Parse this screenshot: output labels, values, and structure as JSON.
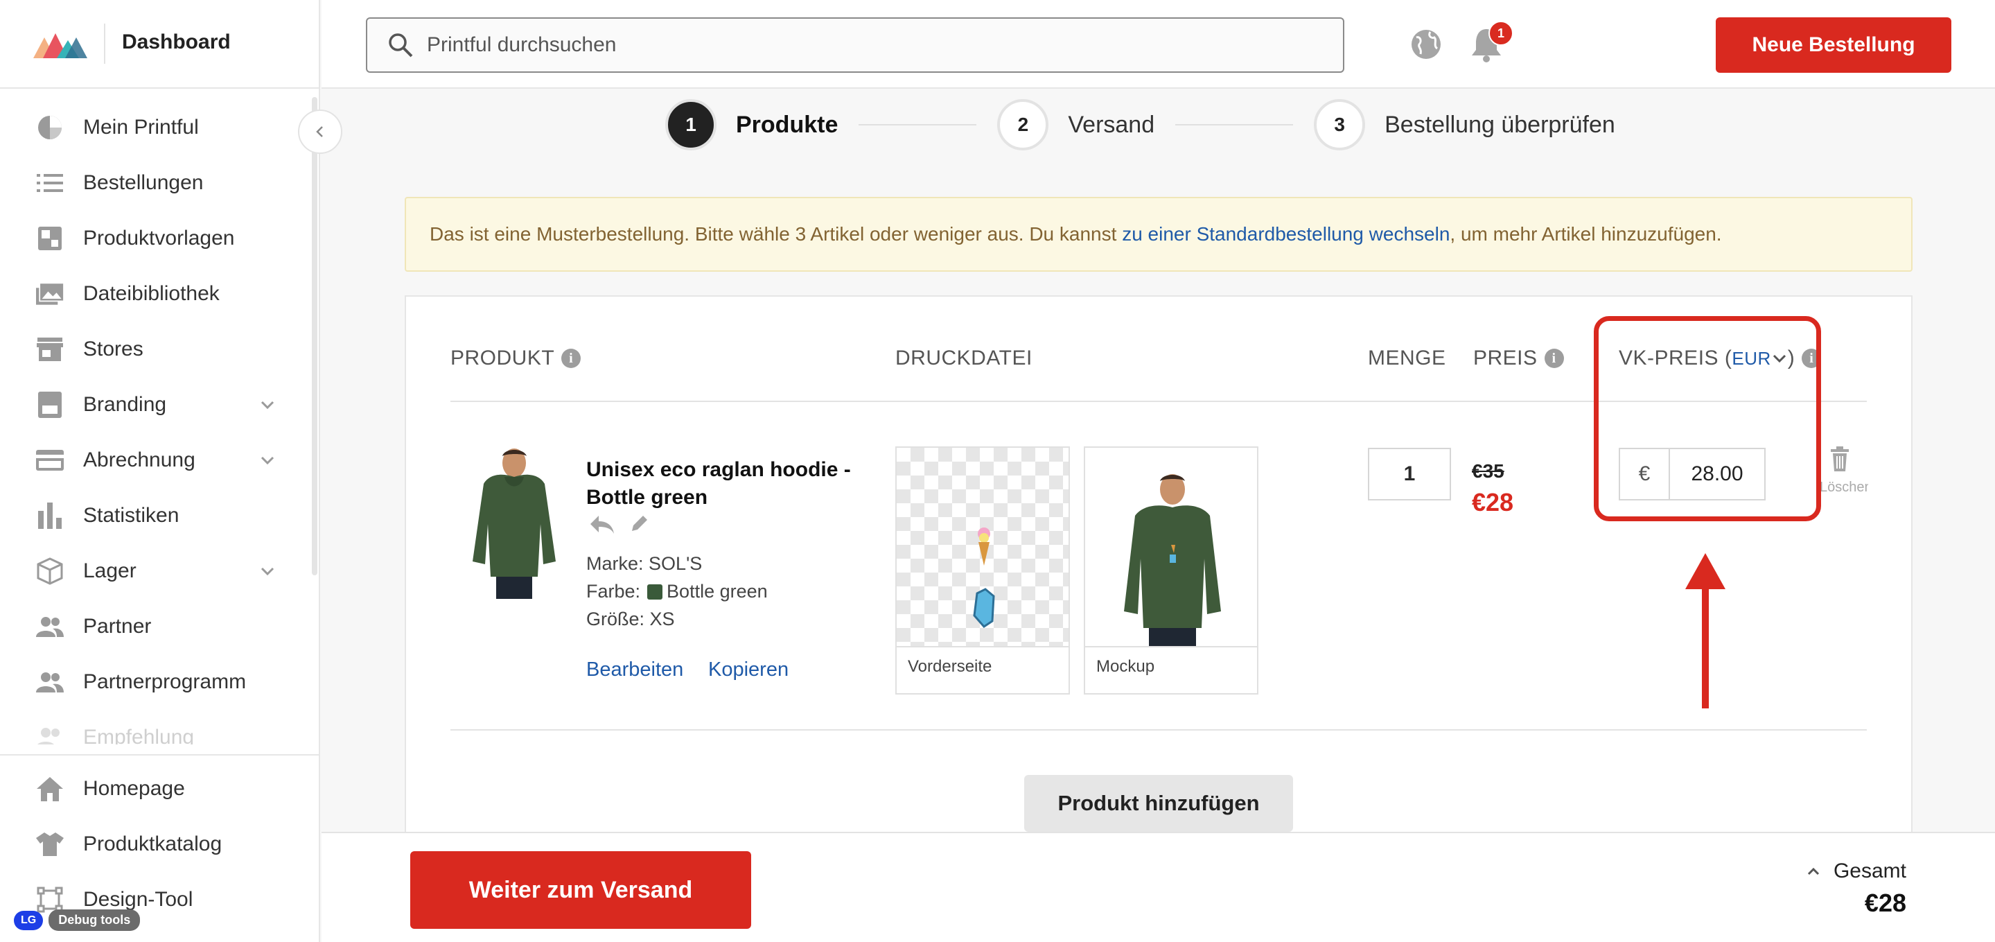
{
  "app": {
    "title": "Dashboard"
  },
  "sidebar": {
    "items": [
      {
        "label": "Mein Printful",
        "icon": "pie-chart-icon"
      },
      {
        "label": "Bestellungen",
        "icon": "list-icon"
      },
      {
        "label": "Produktvorlagen",
        "icon": "template-icon"
      },
      {
        "label": "Dateibibliothek",
        "icon": "images-icon"
      },
      {
        "label": "Stores",
        "icon": "store-icon"
      },
      {
        "label": "Branding",
        "icon": "branding-icon",
        "expandable": true
      },
      {
        "label": "Abrechnung",
        "icon": "credit-card-icon",
        "expandable": true
      },
      {
        "label": "Statistiken",
        "icon": "bar-chart-icon"
      },
      {
        "label": "Lager",
        "icon": "box-icon",
        "expandable": true
      },
      {
        "label": "Partner",
        "icon": "people-icon"
      },
      {
        "label": "Partnerprogramm",
        "icon": "people-icon"
      },
      {
        "label": "Empfehlung",
        "icon": "people-icon"
      }
    ],
    "bottom_items": [
      {
        "label": "Homepage",
        "icon": "home-icon"
      },
      {
        "label": "Produktkatalog",
        "icon": "tshirt-icon"
      },
      {
        "label": "Design-Tool",
        "icon": "design-tool-icon"
      }
    ]
  },
  "debug": {
    "initials": "LG",
    "label": "Debug tools"
  },
  "header": {
    "search_placeholder": "Printful durchsuchen",
    "notification_count": "1",
    "new_order_label": "Neue Bestellung"
  },
  "steps": [
    {
      "number": "1",
      "label": "Produkte",
      "active": true
    },
    {
      "number": "2",
      "label": "Versand",
      "active": false
    },
    {
      "number": "3",
      "label": "Bestellung überprüfen",
      "active": false
    }
  ],
  "notice": {
    "text_before": "Das ist eine Musterbestellung. Bitte wähle 3 Artikel oder weniger aus. Du kannst ",
    "link": "zu einer Standardbestellung wechseln",
    "text_after": ", um mehr Artikel hinzuzufügen."
  },
  "table": {
    "headers": {
      "product": "PRODUKT",
      "print_file": "DRUCKDATEI",
      "quantity": "MENGE",
      "price": "PREIS",
      "retail_price": "VK-PREIS (",
      "currency": "EUR",
      "retail_close": ")"
    },
    "row": {
      "title": "Unisex eco raglan hoodie - Bottle green",
      "brand_label": "Marke:",
      "brand": "SOL'S",
      "color_label": "Farbe:",
      "color": "Bottle green",
      "color_hex": "#3a5a3a",
      "size_label": "Größe:",
      "size": "XS",
      "edit": "Bearbeiten",
      "copy": "Kopieren",
      "files": [
        {
          "caption": "Vorderseite"
        },
        {
          "caption": "Mockup"
        }
      ],
      "quantity": "1",
      "old_price": "€35",
      "price": "€28",
      "retail_currency_symbol": "€",
      "retail_value": "28.00",
      "delete": "Löschen"
    }
  },
  "add_product_label": "Produkt hinzufügen",
  "footer": {
    "next_label": "Weiter zum Versand",
    "total_label": "Gesamt",
    "total_value": "€28"
  },
  "colors": {
    "accent": "#d9291f",
    "link": "#1f5aa8",
    "notice_bg": "#fcf8e3"
  }
}
